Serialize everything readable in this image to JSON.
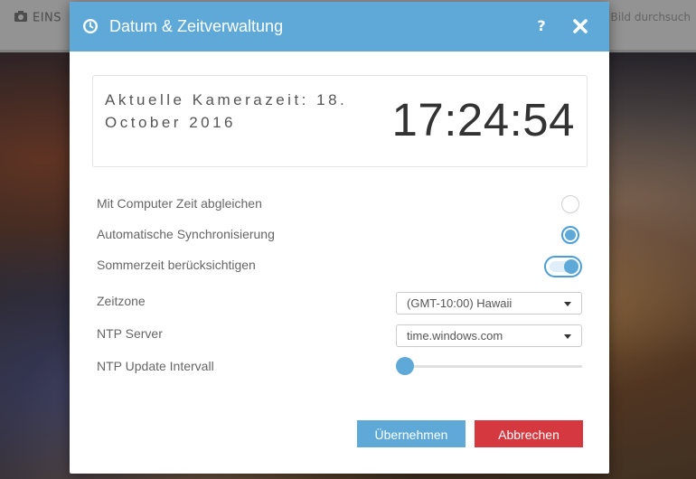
{
  "background": {
    "topbar_left_text": "EINS",
    "topbar_right_text": "Bild durchsuch"
  },
  "dialog": {
    "title": "Datum & Zeitverwaltung",
    "help_label": "?",
    "header_icon": "clock-icon",
    "close_icon": "close-icon",
    "camera_time_label": "Aktuelle Kamerazeit: 18. October 2016",
    "camera_time_value": "17:24:54",
    "sync_computer": {
      "label": "Mit Computer Zeit abgleichen",
      "checked": false
    },
    "auto_sync": {
      "label": "Automatische Synchronisierung",
      "checked": true
    },
    "dst": {
      "label": "Sommerzeit berücksichtigen",
      "enabled": true
    },
    "timezone": {
      "label": "Zeitzone",
      "value": "(GMT-10:00) Hawaii"
    },
    "ntp_server": {
      "label": "NTP Server",
      "value": "time.windows.com"
    },
    "ntp_interval": {
      "label": "NTP Update Intervall",
      "level": 0
    },
    "apply_label": "Übernehmen",
    "cancel_label": "Abbrechen"
  },
  "colors": {
    "accent": "#5ea9d8",
    "danger": "#d5383e"
  }
}
